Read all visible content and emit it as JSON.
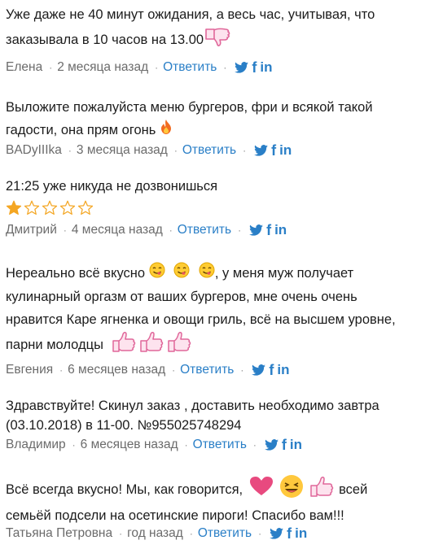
{
  "comments": [
    {
      "text_lines": [
        "Уже даже не 40 минут ожидания, а весь час, учитывая, что",
        "заказывала в 10 часов на 13.00"
      ],
      "author": "Елена",
      "time": "2 месяца назад",
      "reply_label": "Ответить",
      "emojis": [
        "thumbs-down-icon"
      ]
    },
    {
      "text_lines": [
        "Выложите пожалуйста меню бургеров, фри и всякой такой",
        "гадости, она прям огонь"
      ],
      "author": "BADyIIIka",
      "time": "3 месяца назад",
      "reply_label": "Ответить",
      "emojis": [
        "fire-icon"
      ]
    },
    {
      "text_lines": [
        "21:25 уже никуда не дозвонишься"
      ],
      "author": "Дмитрий",
      "time": "4 месяца назад",
      "reply_label": "Ответить",
      "rating": {
        "value": 1,
        "max": 5
      }
    },
    {
      "text_lines": [
        "Нереально всё вкусно",
        ", у меня муж получает",
        "кулинарный оргазм от ваших бургеров, мне очень очень",
        "нравится Каре ягненка и овощи гриль, всё на высшем уровне,",
        "парни молодцы"
      ],
      "author": "Евгения",
      "time": "6 месяцев назад",
      "reply_label": "Ответить",
      "emojis": [
        "yum-face-icon",
        "thumbs-up-icon"
      ]
    },
    {
      "text_lines": [
        "Здравствуйте! Скинул заказ , доставить необходимо завтра",
        "(03.10.2018) в 11-00. №955025748294"
      ],
      "author": "Владимир",
      "time": "6 месяцев назад",
      "reply_label": "Ответить"
    },
    {
      "text_lines": [
        "Всё всегда вкусно! Мы, как говорится,",
        "всей",
        "семьёй подсели на осетинские пироги! Спасибо вам!!!"
      ],
      "author": "Татьяна Петровна",
      "time": "год назад",
      "reply_label": "Ответить",
      "emojis": [
        "heart-icon",
        "laughing-face-icon",
        "thumbs-up-icon"
      ]
    }
  ],
  "share": {
    "twitter": "twitter-icon",
    "facebook": "f",
    "linkedin": "in"
  },
  "colors": {
    "link": "#2a7fc7",
    "meta": "#6b6b6b",
    "text": "#1c1c1c",
    "star": "#f4a623"
  }
}
